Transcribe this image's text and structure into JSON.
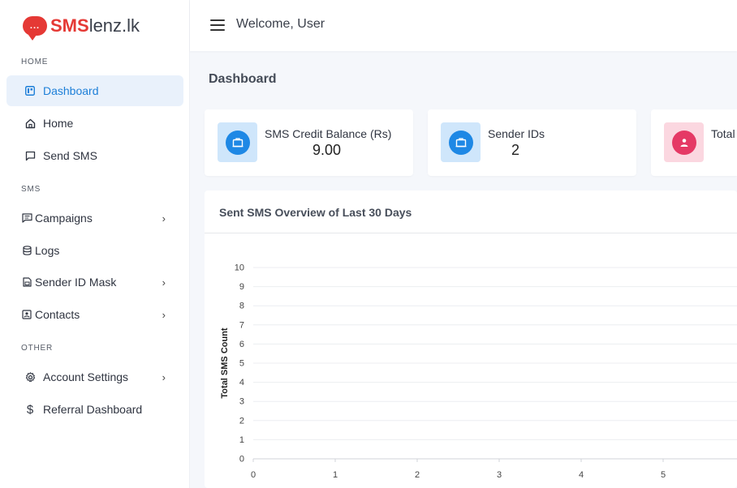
{
  "logo": {
    "brand_bold": "SMS",
    "brand_rest": "lenz.lk",
    "bubble": "..."
  },
  "sidebar": {
    "sections": [
      {
        "title": "HOME"
      },
      {
        "title": "SMS"
      },
      {
        "title": "OTHER"
      }
    ],
    "items": [
      {
        "label": "Dashboard",
        "icon": "dashboard-icon",
        "active": true
      },
      {
        "label": "Home",
        "icon": "home-icon"
      },
      {
        "label": "Send SMS",
        "icon": "message-icon"
      },
      {
        "label": "Campaigns",
        "icon": "campaigns-icon",
        "chevron": "›"
      },
      {
        "label": "Logs",
        "icon": "database-icon"
      },
      {
        "label": "Sender ID Mask",
        "icon": "sim-card-icon",
        "chevron": "›"
      },
      {
        "label": "Contacts",
        "icon": "contacts-icon",
        "chevron": "›"
      },
      {
        "label": "Account Settings",
        "icon": "gear-icon",
        "chevron": "›"
      },
      {
        "label": "Referral Dashboard",
        "icon": "dollar-icon"
      }
    ]
  },
  "topbar": {
    "welcome": "Welcome, User"
  },
  "page": {
    "title": "Dashboard"
  },
  "cards": [
    {
      "label": "SMS Credit Balance (Rs)",
      "value": "9.00",
      "icon": "briefcase-icon",
      "color": "#1e88e5",
      "bg": "#cfe6fb"
    },
    {
      "label": "Sender IDs",
      "value": "2",
      "icon": "briefcase-icon",
      "color": "#1e88e5",
      "bg": "#cfe6fb"
    },
    {
      "label": "Total",
      "value": "",
      "icon": "user-icon",
      "color": "#e53965",
      "bg": "#fbd7e0"
    }
  ],
  "chart": {
    "title": "Sent SMS Overview of Last 30 Days"
  },
  "chart_data": {
    "type": "line",
    "title": "Sent SMS Overview of Last 30 Days",
    "xlabel": "",
    "ylabel": "Total SMS Count",
    "x_ticks": [
      "0",
      "1",
      "2",
      "3",
      "4",
      "5"
    ],
    "y_ticks": [
      "0",
      "1",
      "2",
      "3",
      "4",
      "5",
      "6",
      "7",
      "8",
      "9",
      "10"
    ],
    "ylim": [
      0,
      10
    ],
    "grid": true,
    "series": []
  }
}
